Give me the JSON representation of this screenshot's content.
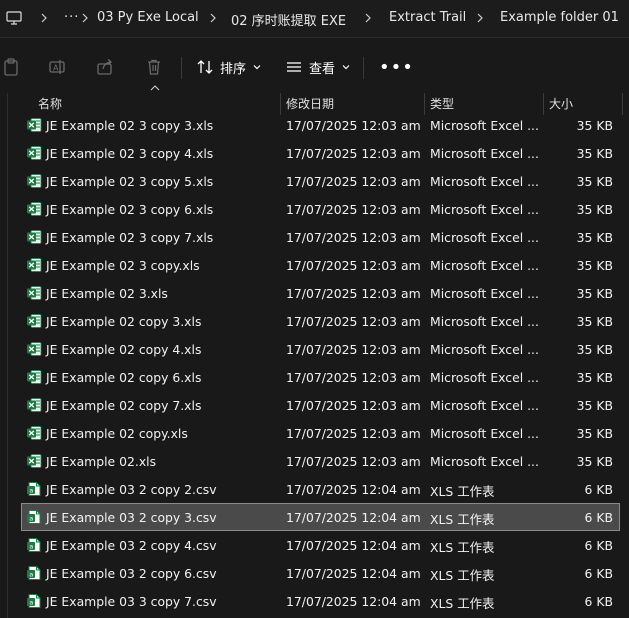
{
  "breadcrumb": {
    "overflow_label": "···",
    "items": [
      "03 Py Exe Local",
      "02 序时账提取 EXE",
      "Extract Trail",
      "Example folder 01"
    ]
  },
  "toolbar": {
    "sort_label": "排序",
    "view_label": "查看",
    "more_label": "•••"
  },
  "columns": {
    "name": "名称",
    "date": "修改日期",
    "type": "类型",
    "size": "大小"
  },
  "colors": {
    "background": "#191919",
    "selected_row": "#4a4a4a",
    "excel_green": "#1f7a45",
    "text": "#f2f2f2"
  },
  "files": [
    {
      "name": "JE Example 02 3 copy 3.xls",
      "date": "17/07/2025 12:03 am",
      "type": "Microsoft Excel ...",
      "size": "35 KB",
      "icon": "excel-xls-icon"
    },
    {
      "name": "JE Example 02 3 copy 4.xls",
      "date": "17/07/2025 12:03 am",
      "type": "Microsoft Excel ...",
      "size": "35 KB",
      "icon": "excel-xls-icon"
    },
    {
      "name": "JE Example 02 3 copy 5.xls",
      "date": "17/07/2025 12:03 am",
      "type": "Microsoft Excel ...",
      "size": "35 KB",
      "icon": "excel-xls-icon"
    },
    {
      "name": "JE Example 02 3 copy 6.xls",
      "date": "17/07/2025 12:03 am",
      "type": "Microsoft Excel ...",
      "size": "35 KB",
      "icon": "excel-xls-icon"
    },
    {
      "name": "JE Example 02 3 copy 7.xls",
      "date": "17/07/2025 12:03 am",
      "type": "Microsoft Excel ...",
      "size": "35 KB",
      "icon": "excel-xls-icon"
    },
    {
      "name": "JE Example 02 3 copy.xls",
      "date": "17/07/2025 12:03 am",
      "type": "Microsoft Excel ...",
      "size": "35 KB",
      "icon": "excel-xls-icon"
    },
    {
      "name": "JE Example 02 3.xls",
      "date": "17/07/2025 12:03 am",
      "type": "Microsoft Excel ...",
      "size": "35 KB",
      "icon": "excel-xls-icon"
    },
    {
      "name": "JE Example 02 copy 3.xls",
      "date": "17/07/2025 12:03 am",
      "type": "Microsoft Excel ...",
      "size": "35 KB",
      "icon": "excel-xls-icon"
    },
    {
      "name": "JE Example 02 copy 4.xls",
      "date": "17/07/2025 12:03 am",
      "type": "Microsoft Excel ...",
      "size": "35 KB",
      "icon": "excel-xls-icon"
    },
    {
      "name": "JE Example 02 copy 6.xls",
      "date": "17/07/2025 12:03 am",
      "type": "Microsoft Excel ...",
      "size": "35 KB",
      "icon": "excel-xls-icon"
    },
    {
      "name": "JE Example 02 copy 7.xls",
      "date": "17/07/2025 12:03 am",
      "type": "Microsoft Excel ...",
      "size": "35 KB",
      "icon": "excel-xls-icon"
    },
    {
      "name": "JE Example 02 copy.xls",
      "date": "17/07/2025 12:03 am",
      "type": "Microsoft Excel ...",
      "size": "35 KB",
      "icon": "excel-xls-icon"
    },
    {
      "name": "JE Example 02.xls",
      "date": "17/07/2025 12:03 am",
      "type": "Microsoft Excel ...",
      "size": "35 KB",
      "icon": "excel-xls-icon"
    },
    {
      "name": "JE Example 03 2 copy 2.csv",
      "date": "17/07/2025 12:04 am",
      "type": "XLS 工作表",
      "size": "6 KB",
      "icon": "excel-csv-icon"
    },
    {
      "name": "JE Example 03 2 copy 3.csv",
      "date": "17/07/2025 12:04 am",
      "type": "XLS 工作表",
      "size": "6 KB",
      "icon": "excel-csv-icon",
      "selected": true
    },
    {
      "name": "JE Example 03 2 copy 4.csv",
      "date": "17/07/2025 12:04 am",
      "type": "XLS 工作表",
      "size": "6 KB",
      "icon": "excel-csv-icon"
    },
    {
      "name": "JE Example 03 2 copy 6.csv",
      "date": "17/07/2025 12:04 am",
      "type": "XLS 工作表",
      "size": "6 KB",
      "icon": "excel-csv-icon"
    },
    {
      "name": "JE Example 03 3 copy 7.csv",
      "date": "17/07/2025 12:04 am",
      "type": "XLS 工作表",
      "size": "6 KB",
      "icon": "excel-csv-icon"
    }
  ]
}
